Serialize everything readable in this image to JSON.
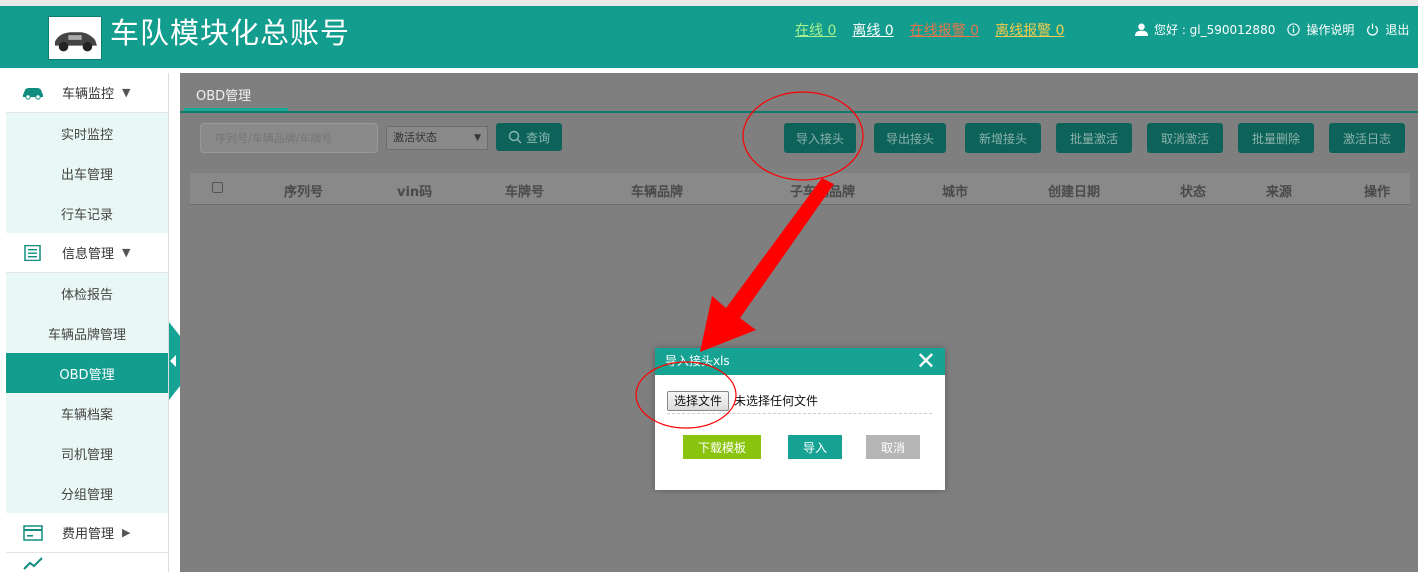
{
  "header": {
    "title": "车队模块化总账号",
    "links": {
      "online": "在线 0",
      "offline": "离线 0",
      "online_alarm": "在线报警 0",
      "offline_alarm": "离线报警 0"
    },
    "user_greeting": "您好 : gl_590012880",
    "help": "操作说明",
    "logout": "退出"
  },
  "sidebar": {
    "group1": "车辆监控",
    "group1_items": [
      "实时监控",
      "出车管理",
      "行车记录"
    ],
    "group2": "信息管理",
    "group2_items": [
      "体检报告",
      "车辆品牌管理",
      "OBD管理",
      "车辆档案",
      "司机管理",
      "分组管理"
    ],
    "group3": "费用管理",
    "active_item": "OBD管理"
  },
  "main": {
    "tab": "OBD管理",
    "search_placeholder": "序列号/车辆品牌/车牌号",
    "status_select": "激活状态",
    "query": "查询",
    "actions": [
      "导入接头",
      "导出接头",
      "新增接头",
      "批量激活",
      "取消激活",
      "批量删除",
      "激活日志"
    ],
    "columns": [
      "序列号",
      "vin码",
      "车牌号",
      "车辆品牌",
      "子车辆品牌",
      "城市",
      "创建日期",
      "状态",
      "来源",
      "操作"
    ]
  },
  "dialog": {
    "title": "导入接头xls",
    "choose_file": "选择文件",
    "no_file": "未选择任何文件",
    "download_template": "下载模板",
    "import": "导入",
    "cancel": "取消"
  },
  "colors": {
    "brand": "#129d8e",
    "annotation": "#ff0000",
    "download_btn": "#8bc40e"
  }
}
